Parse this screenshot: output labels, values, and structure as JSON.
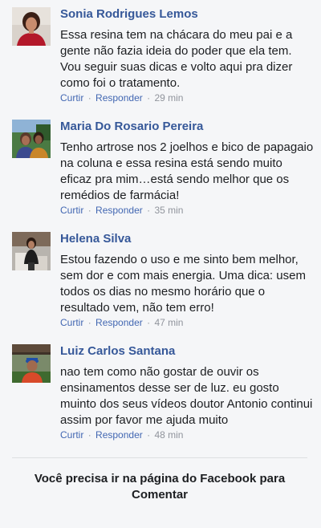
{
  "comments": [
    {
      "author": "Sonia Rodrigues Lemos",
      "text": "Essa resina tem na chácara do meu pai e a gente não fazia ideia do poder que ela tem. Vou seguir suas dicas e volto aqui pra dizer como foi o tratamento.",
      "like_label": "Curtir",
      "reply_label": "Responder",
      "time": "29 min",
      "avatar_icon": "user-photo-icon"
    },
    {
      "author": "Maria Do Rosario Pereira",
      "text": "Tenho artrose nos 2 joelhos e bico de papagaio na coluna e essa resina está sendo muito eficaz pra mim…está sendo melhor que os remédios de farmácia!",
      "like_label": "Curtir",
      "reply_label": "Responder",
      "time": "35 min",
      "avatar_icon": "user-photo-icon"
    },
    {
      "author": "Helena Silva",
      "text": "Estou fazendo o uso e me sinto bem melhor, sem dor e com mais energia. Uma dica: usem todos os dias no mesmo horário que o resultado vem, não tem erro!",
      "like_label": "Curtir",
      "reply_label": "Responder",
      "time": "47 min",
      "avatar_icon": "user-photo-icon"
    },
    {
      "author": "Luiz Carlos Santana",
      "text": "nao tem como não gostar de ouvir os ensinamentos desse ser de luz. eu gosto muinto dos seus vídeos doutor Antonio continui assim por favor me ajuda muito",
      "like_label": "Curtir",
      "reply_label": "Responder",
      "time": "48 min",
      "avatar_icon": "user-photo-icon"
    }
  ],
  "separator": "·",
  "footer": {
    "message": "Você precisa ir na página do Facebook para Comentar"
  },
  "colors": {
    "background": "#f5f6f8",
    "author": "#365899",
    "link": "#4267b2",
    "meta": "#90949c",
    "text": "#1c1e21",
    "divider": "#dddfe2"
  }
}
